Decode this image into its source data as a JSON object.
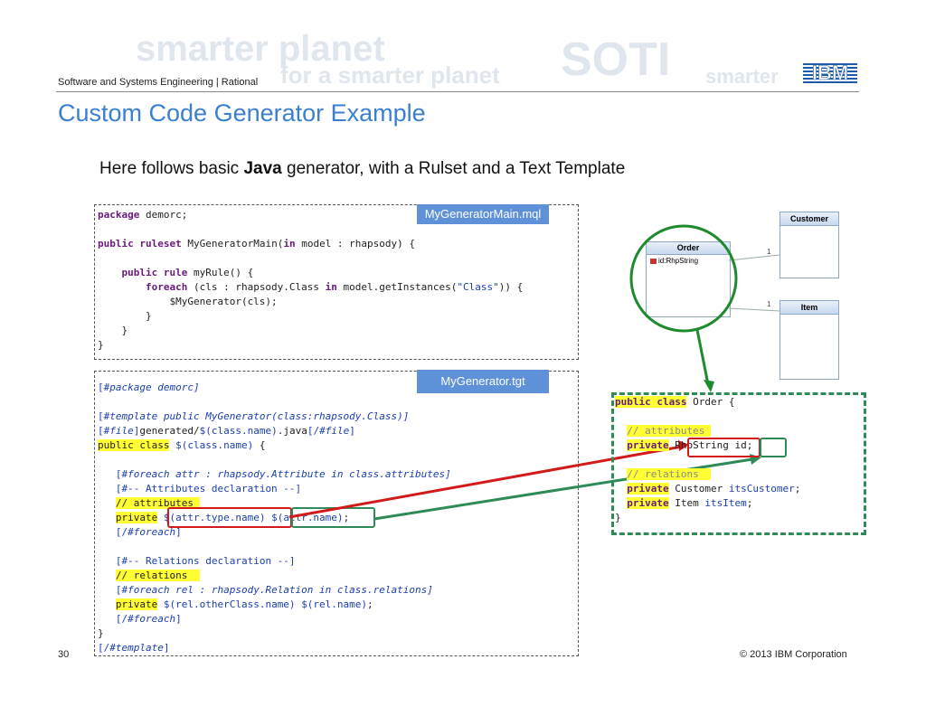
{
  "header": {
    "breadcrumb": "Software and Systems Engineering | Rational",
    "watermarks": [
      "smarter planet",
      "for a smarter planet",
      "SOTI",
      "smarter"
    ],
    "logo_text": "IBM"
  },
  "slide": {
    "title": "Custom Code Generator Example",
    "subtitle_pre": "Here follows basic ",
    "subtitle_bold": "Java",
    "subtitle_post": " generator, with a Rulset and a Text Template"
  },
  "ruleset": {
    "tag": "MyGeneratorMain.mql"
  },
  "template": {
    "tag": "MyGenerator.tgt"
  },
  "diagram": {
    "order_title": "Order",
    "order_attr": "id:RhpString",
    "customer_title": "Customer",
    "item_title": "Item",
    "mult_customer": "1",
    "mult_item": "1"
  },
  "footer": {
    "page": "30",
    "copyright": "© 2013 IBM Corporation"
  },
  "colors": {
    "title": "#3a7fd0",
    "tag_bg": "#5f91d8",
    "highlight": "#ffff33",
    "red_box": "#d21a1a",
    "green_box": "#2e8b57",
    "circle": "#1e8a2e"
  }
}
